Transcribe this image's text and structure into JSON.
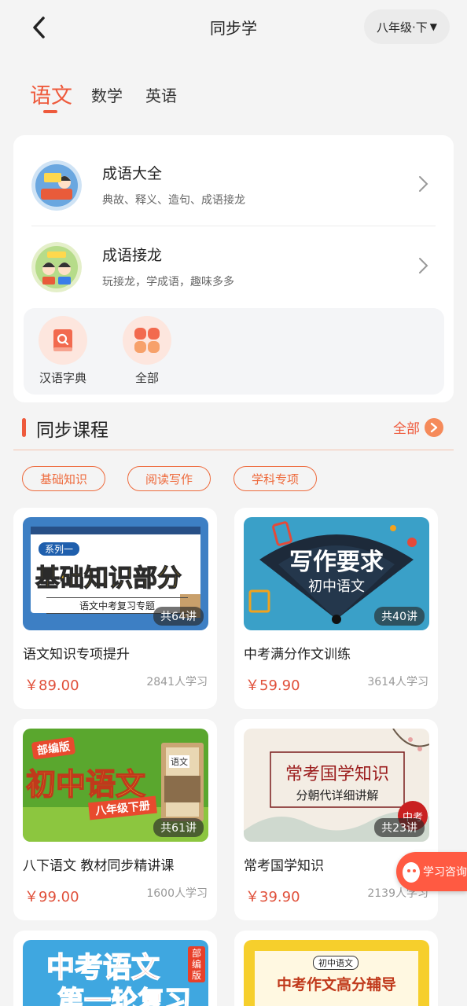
{
  "header": {
    "title": "同步学",
    "grade": "八年级·下"
  },
  "subjects": [
    "语文",
    "数学",
    "英语"
  ],
  "features": [
    {
      "title": "成语大全",
      "subtitle": "典故、释义、造句、成语接龙"
    },
    {
      "title": "成语接龙",
      "subtitle": "玩接龙，学成语，趣味多多"
    }
  ],
  "tools": [
    {
      "label": "汉语字典"
    },
    {
      "label": "全部"
    }
  ],
  "section": {
    "title": "同步课程",
    "all": "全部"
  },
  "chips": [
    "基础知识",
    "阅读写作",
    "学科专项"
  ],
  "courses": [
    {
      "title": "语文知识专项提升",
      "price": "￥89.00",
      "students": "2841人学习",
      "count": "共64讲",
      "thumb": {
        "tag": "系列一",
        "main": "基础知识部分",
        "sub": "语文中考复习专题"
      }
    },
    {
      "title": "中考满分作文训练",
      "price": "￥59.90",
      "students": "3614人学习",
      "count": "共40讲",
      "thumb": {
        "main": "写作要求",
        "sub": "初中语文"
      }
    },
    {
      "title": "八下语文 教材同步精讲课",
      "price": "￥99.00",
      "students": "1600人学习",
      "count": "共61讲",
      "thumb": {
        "tag": "部编版",
        "main": "初中语文",
        "sub": "八年级下册",
        "book": "语文"
      }
    },
    {
      "title": "常考国学知识",
      "price": "￥39.90",
      "students": "2139人学习",
      "count": "共23讲",
      "thumb": {
        "main": "常考国学知识",
        "sub": "分朝代详细讲解",
        "seal": "中考"
      }
    },
    {
      "thumb": {
        "main": "中考语文",
        "sub": "第一轮复习",
        "tag": "部编版"
      }
    },
    {
      "thumb": {
        "tag": "初中语文",
        "main": "中考作文高分辅导"
      }
    }
  ],
  "float": {
    "label": "学习咨询"
  }
}
